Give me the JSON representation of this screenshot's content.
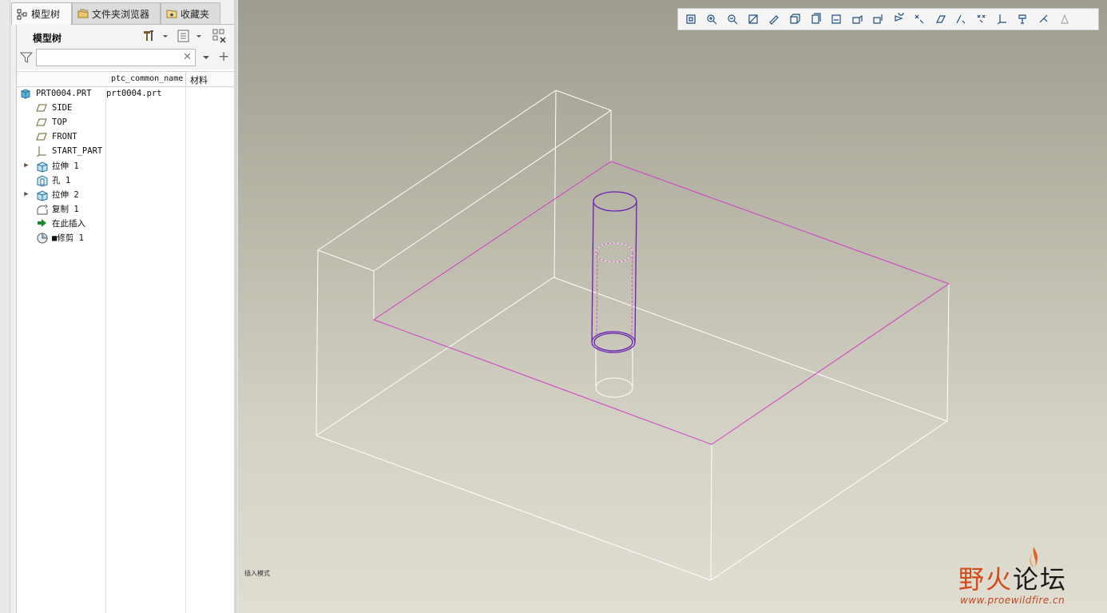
{
  "tabs": [
    {
      "label": "模型树",
      "icon": "model-tree-icon",
      "active": true
    },
    {
      "label": "文件夹浏览器",
      "icon": "folder-browser-icon",
      "active": false
    },
    {
      "label": "收藏夹",
      "icon": "favorites-icon",
      "active": false
    }
  ],
  "tree": {
    "title": "模型树",
    "search": {
      "value": "",
      "placeholder": ""
    },
    "columns": [
      "ptc_common_name",
      "材料"
    ],
    "items": [
      {
        "label": "PRT0004.PRT",
        "icon": "part-icon",
        "expandable": false,
        "value": "prt0004.prt",
        "indent": 0
      },
      {
        "label": "SIDE",
        "icon": "datum-plane-icon",
        "expandable": false,
        "value": "",
        "indent": 1
      },
      {
        "label": "TOP",
        "icon": "datum-plane-icon",
        "expandable": false,
        "value": "",
        "indent": 1
      },
      {
        "label": "FRONT",
        "icon": "datum-plane-icon",
        "expandable": false,
        "value": "",
        "indent": 1
      },
      {
        "label": "START_PART",
        "icon": "coordinate-system-icon",
        "expandable": false,
        "value": "",
        "indent": 1
      },
      {
        "label": "拉伸 1",
        "icon": "extrude-icon",
        "expandable": true,
        "value": "",
        "indent": 1
      },
      {
        "label": "孔 1",
        "icon": "hole-icon",
        "expandable": false,
        "value": "",
        "indent": 1
      },
      {
        "label": "拉伸 2",
        "icon": "extrude-icon",
        "expandable": true,
        "value": "",
        "indent": 1
      },
      {
        "label": "复制 1",
        "icon": "copy-icon",
        "expandable": false,
        "value": "",
        "indent": 1
      },
      {
        "label": "在此插入",
        "icon": "insert-here-arrow-icon",
        "expandable": false,
        "value": "",
        "indent": 1
      },
      {
        "label": "■修剪 1",
        "icon": "trim-icon",
        "expandable": false,
        "value": "",
        "indent": 1
      }
    ]
  },
  "viewport": {
    "toolbar_icons": [
      "refit-icon",
      "zoom-in-icon",
      "zoom-out-icon",
      "repaint-icon",
      "shading-icon",
      "view-orientation-icon",
      "saved-views-icon",
      "display-style-icon",
      "perspective-icon",
      "section-icon",
      "spin-center-icon",
      "plane-display-icon",
      "axis-display-icon",
      "point-display-icon",
      "csys-display-icon",
      "annotation-display-icon",
      "sketch-icon",
      "appearance-icon",
      "next-icon"
    ],
    "status_text": "插入模式"
  },
  "watermark": {
    "title_part1": "野火",
    "title_part2": "论坛",
    "url": "www.proewildfire.cn"
  },
  "colors": {
    "edge": "#ffffff",
    "highlight": "#d23cc8",
    "cylinder": "#6a1fb0",
    "brand": "#d24a1a"
  }
}
